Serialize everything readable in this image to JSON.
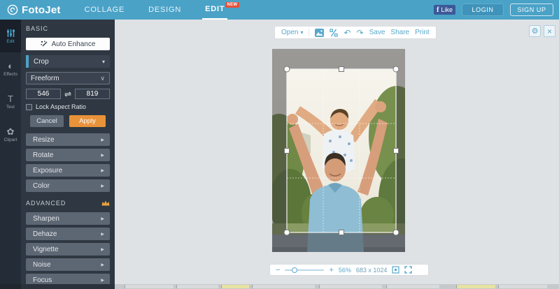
{
  "topbar": {
    "brand": "FotoJet",
    "nav": [
      {
        "label": "COLLAGE"
      },
      {
        "label": "DESIGN"
      },
      {
        "label": "EDIT",
        "badge": "NEW"
      }
    ],
    "facebook_like": "Like",
    "login": "LOGIN",
    "signup": "SIGN UP"
  },
  "sidebar": {
    "items": [
      {
        "label": "Edit"
      },
      {
        "label": "Effects"
      },
      {
        "label": "Text"
      },
      {
        "label": "Clipart"
      }
    ]
  },
  "panel": {
    "basic_label": "BASIC",
    "auto_enhance_label": "Auto Enhance",
    "crop": {
      "label": "Crop",
      "preset": "Freeform",
      "width": "546",
      "height": "819",
      "lock_label": "Lock Aspect Ratio",
      "cancel_label": "Cancel",
      "apply_label": "Apply"
    },
    "basic_tools": [
      "Resize",
      "Rotate",
      "Exposure",
      "Color"
    ],
    "advanced_label": "ADVANCED",
    "advanced_tools": [
      "Sharpen",
      "Dehaze",
      "Vignette",
      "Noise",
      "Focus"
    ]
  },
  "toolbar": {
    "open_label": "Open",
    "save_label": "Save",
    "share_label": "Share",
    "print_label": "Print"
  },
  "statusbar": {
    "zoom_level": "56%",
    "image_dimensions": "683 x 1024"
  },
  "icons": {
    "caret_down": "▾",
    "select_chevron": "∨",
    "arrow_right": "▶",
    "swap": "⇌",
    "minus": "−",
    "plus": "+",
    "undo": "↶",
    "redo": "↷",
    "gear": "⚙",
    "close": "×",
    "fb": "f",
    "text_tool": "T",
    "effects_tool": "◐",
    "clipart_tool": "✿"
  },
  "colors": {
    "accent_blue": "#4aa3c8",
    "apply_orange": "#e8923a",
    "badge_red": "#e8503a",
    "crown_gold": "#e8a33d"
  }
}
